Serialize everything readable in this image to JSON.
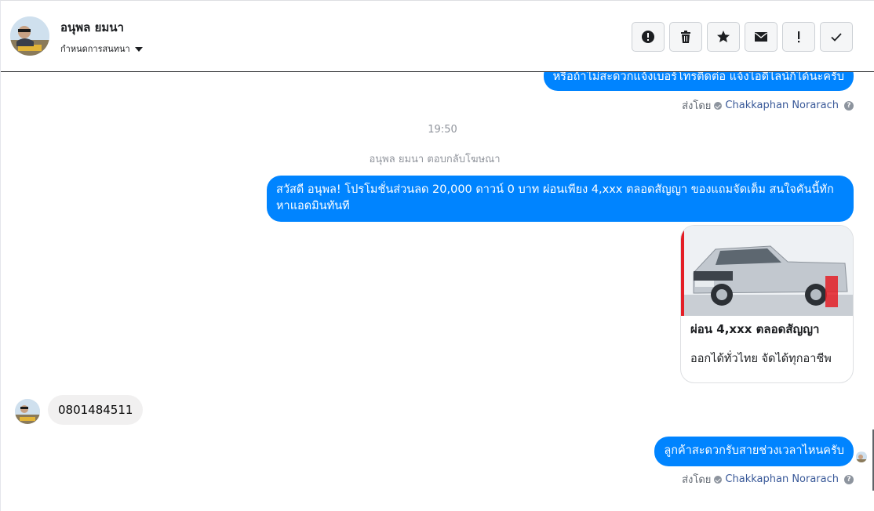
{
  "header": {
    "contact_name": "อนุพล ยมนา",
    "assign_label": "กำหนดการสนทนา",
    "actions": [
      {
        "name": "mark-spam-button",
        "icon": "alert-circle-icon"
      },
      {
        "name": "delete-button",
        "icon": "trash-icon"
      },
      {
        "name": "star-button",
        "icon": "star-icon"
      },
      {
        "name": "mark-unread-button",
        "icon": "envelope-icon"
      },
      {
        "name": "mark-important-button",
        "icon": "exclamation-icon"
      },
      {
        "name": "mark-done-button",
        "icon": "check-icon"
      }
    ]
  },
  "messages": {
    "top_partial": {
      "text": "หรือถ้าไม่สะดวกแจ้งเบอร์โทรติดต่อ แจ้งไอดีไลน์ก็ได้นะครับ",
      "sent_by_prefix": "ส่งโดย",
      "sent_by_name": "Chakkaphan Norarach"
    },
    "timestamp": "19:50",
    "reply_note": "อนุพล ยมนา ตอบกลับโฆษณา",
    "promo_text": "สวัสดี อนุพล! โปรโมชั่นส่วนลด 20,000 ดาวน์ 0 บาท ผ่อนเพียง 4,xxx ตลอดสัญญา ของแถมจัดเต็ม สนใจคันนี้ทักหาแอดมินทันที",
    "card": {
      "title": "ผ่อน 4,xxx ตลอดสัญญา",
      "subtitle": "ออกได้ทั่วไทย จัดได้ทุกอาชีพ"
    },
    "incoming_phone": "0801484511",
    "last_outgoing": {
      "text": "ลูกค้าสะดวกรับสายช่วงเวลาไหนครับ",
      "sent_by_prefix": "ส่งโดย",
      "sent_by_name": "Chakkaphan Norarach"
    }
  },
  "colors": {
    "outgoing_bubble": "#0084ff",
    "incoming_bubble": "#f1f0f0",
    "link": "#385898"
  }
}
